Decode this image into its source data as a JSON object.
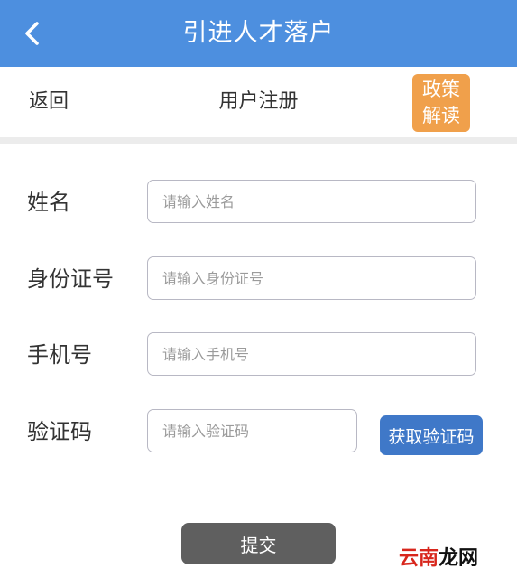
{
  "header": {
    "title": "引进人才落户",
    "back_icon": "chevron-left-icon",
    "color": "#4d8fdf"
  },
  "subheader": {
    "back_label": "返回",
    "title": "用户注册",
    "policy_button": {
      "line1": "政策",
      "line2": "解读",
      "color": "#f0a04b"
    }
  },
  "form": {
    "name": {
      "label": "姓名",
      "placeholder": "请输入姓名"
    },
    "id_number": {
      "label": "身份证号",
      "placeholder": "请输入身份证号"
    },
    "phone": {
      "label": "手机号",
      "placeholder": "请输入手机号"
    },
    "code": {
      "label": "验证码",
      "placeholder": "请输入验证码",
      "button_label": "获取验证码",
      "button_color": "#3f78c8"
    },
    "submit_label": "提交",
    "submit_color": "#5f5f5f"
  },
  "watermark": {
    "part1": "云南",
    "part2": "龙网"
  }
}
